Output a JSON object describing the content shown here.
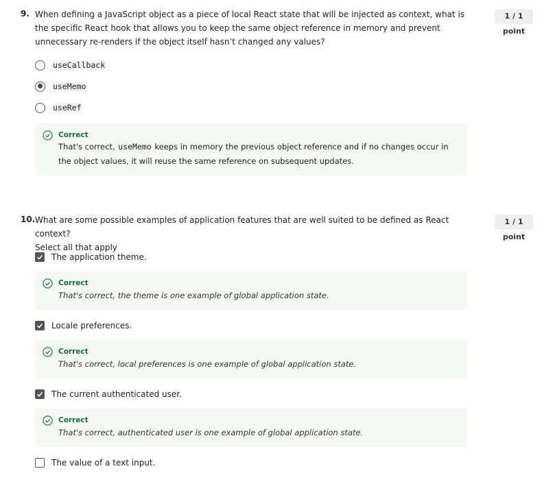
{
  "q9": {
    "number": "9.",
    "text": "When defining a JavaScript object as a piece of local React state that will be injected as context, what is the specific React hook that allows you to keep the same object reference in memory and prevent unnecessary re-renders if the object itself hasn’t changed any values?",
    "points": "1 / 1 point",
    "options": [
      {
        "label": "useCallback",
        "selected": false
      },
      {
        "label": "useMemo",
        "selected": true
      },
      {
        "label": "useRef",
        "selected": false
      }
    ],
    "feedback": {
      "title": "Correct",
      "text_before": "That's correct, ",
      "code": "useMemo",
      "text_after": " keeps in memory the previous object reference and if no changes occur in the object values, it will reuse the same reference on subsequent updates."
    }
  },
  "q10": {
    "number": "10.",
    "text_line1": "What are some possible examples of application features that are well suited to be defined as React context?",
    "text_line2": "Select all that apply",
    "points": "1 / 1 point",
    "options": [
      {
        "label": "The application theme.",
        "checked": true,
        "feedback_title": "Correct",
        "feedback_text": "That's correct, the theme is one example of global application state."
      },
      {
        "label": "Locale preferences.",
        "checked": true,
        "feedback_title": "Correct",
        "feedback_text": "That's correct, local preferences is one example of global application state."
      },
      {
        "label": "The current authenticated user.",
        "checked": true,
        "feedback_title": "Correct",
        "feedback_text": "That's correct, authenticated user is one example of global application state."
      },
      {
        "label": "The value of a text input.",
        "checked": false
      }
    ]
  },
  "colors": {
    "correct_green": "#1d6b3e",
    "feedback_bg": "#f4f8f5",
    "points_bg": "#eeeeee"
  }
}
